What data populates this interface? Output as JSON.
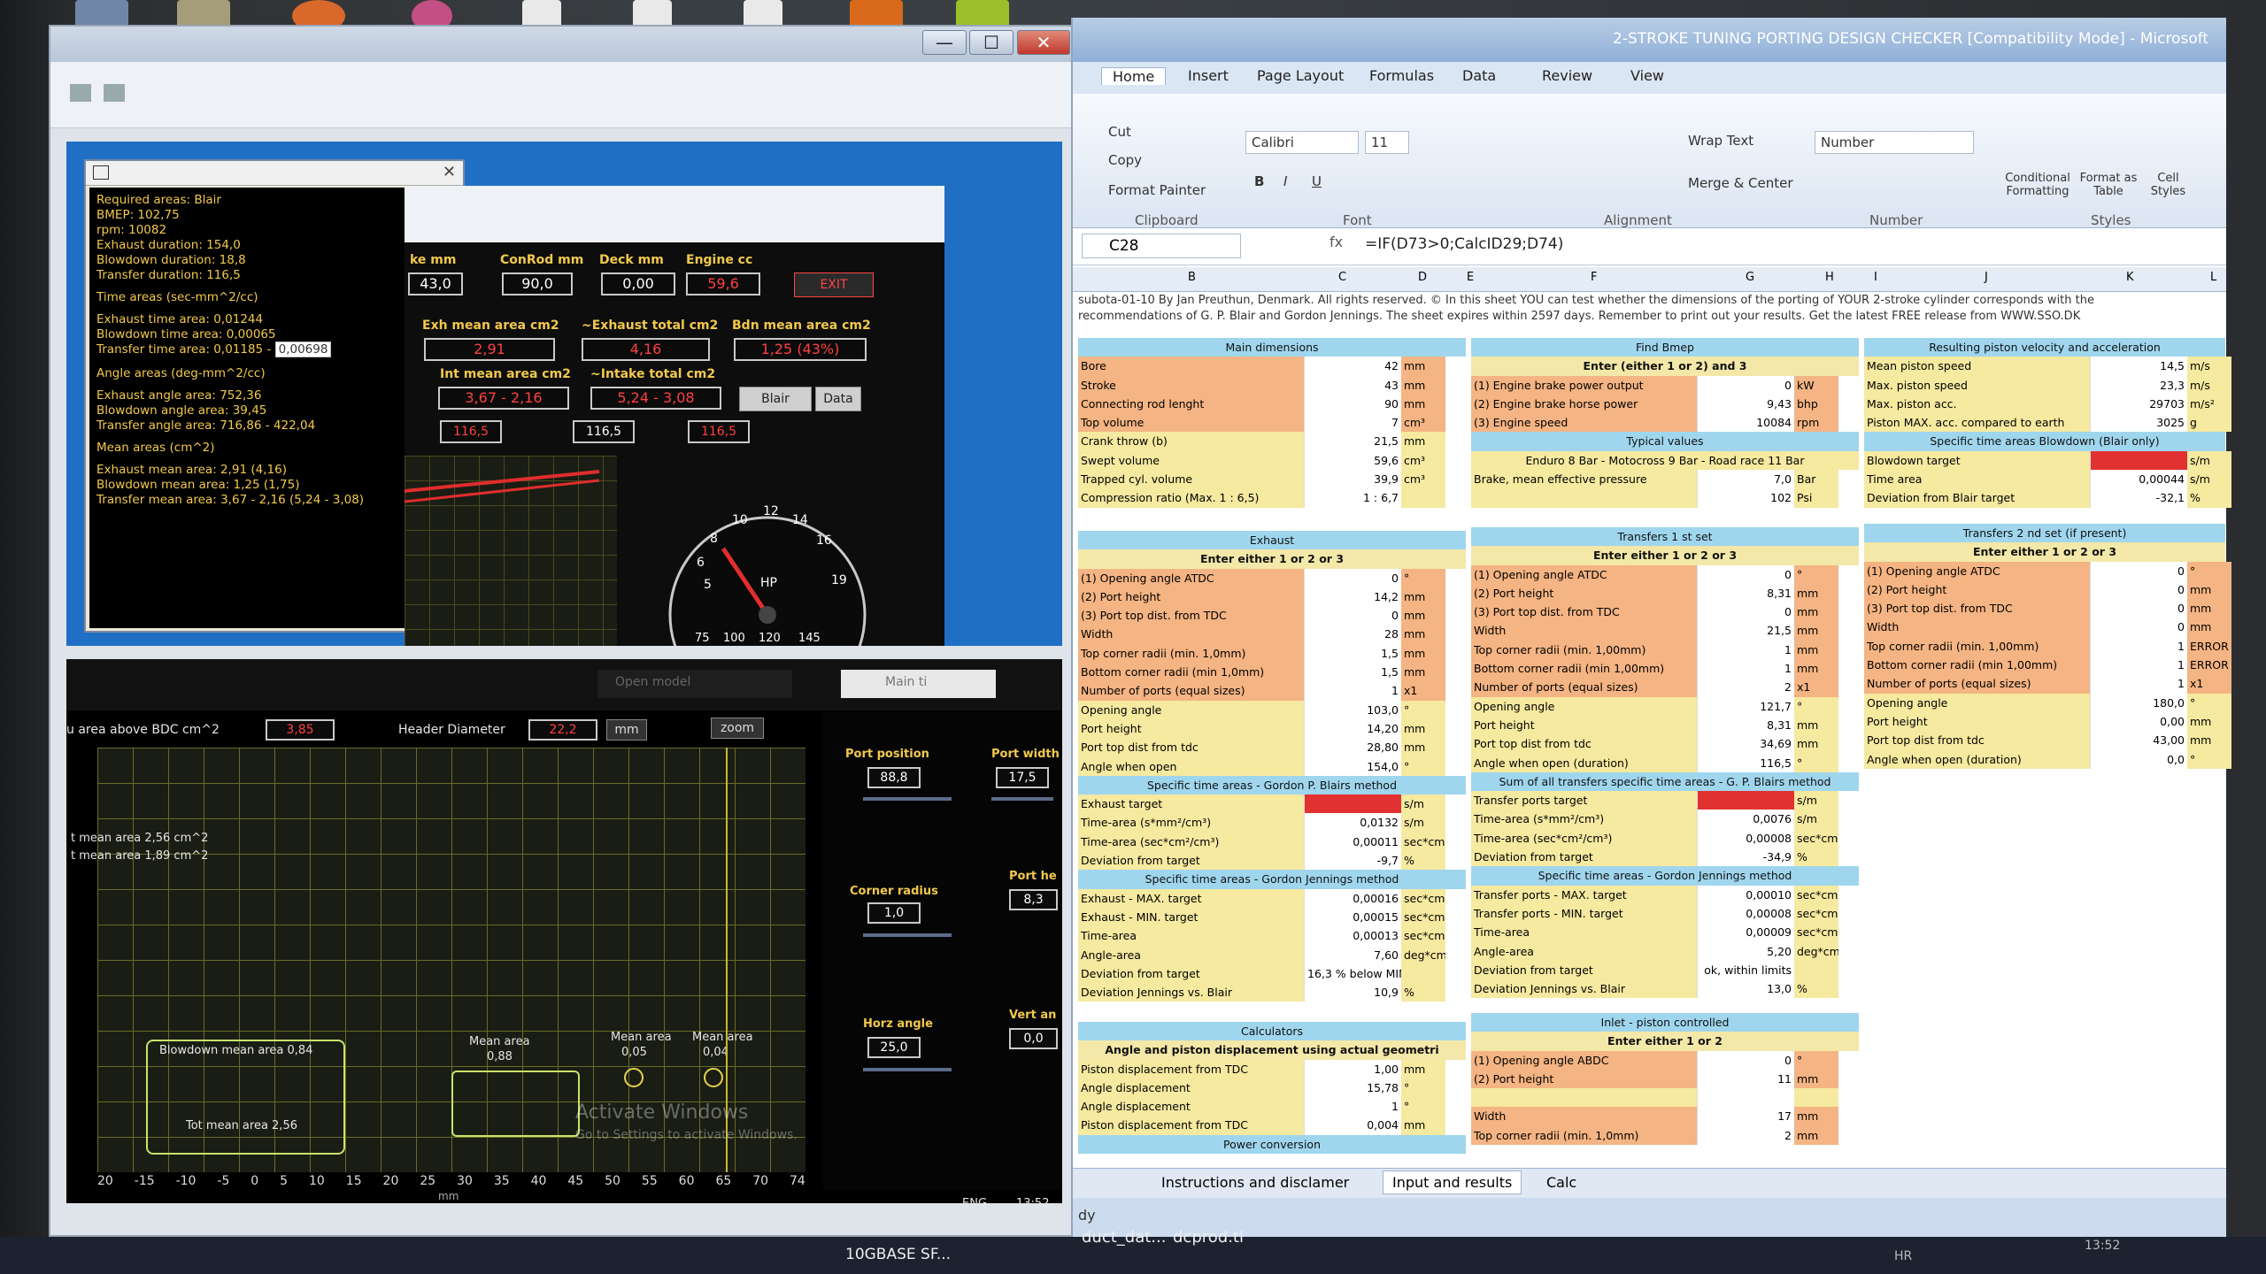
{
  "desktop": {
    "taskbar_items": [
      "10GBASE SF...",
      "duct_dat...",
      "dcprod.tl"
    ],
    "clock": "13:52",
    "lang": "ENG",
    "lang2": "HR"
  },
  "leftwin": {
    "close_label": "✕",
    "min_label": "—",
    "max_label": "☐"
  },
  "info": {
    "lines": [
      "Required areas: Blair",
      "BMEP: 102,75",
      "rpm: 10082",
      "Exhaust duration: 154,0",
      "Blowdown duration: 18,8",
      "Transfer duration: 116,5",
      "",
      "Time areas (sec-mm^2/cc)",
      "",
      "Exhaust time area: 0,01244",
      "Blowdown time area: 0,00065",
      "",
      "",
      "Angle areas (deg-mm^2/cc)",
      "",
      "Exhaust angle area: 752,36",
      "Blowdown angle area: 39,45",
      "Transfer angle area: 716,86 - 422,04",
      "",
      "Mean areas (cm^2)",
      "",
      "Exhaust mean area: 2,91  (4,16)",
      "Blowdown mean area: 1,25  (1,75)",
      "Transfer mean area: 3,67 - 2,16  (5,24 - 3,08)"
    ],
    "transfer_time_label": "Transfer time area: 0,01185 -",
    "transfer_time_sel": "0,00698"
  },
  "tool": {
    "stroke_label": "ke mm",
    "stroke_val": "43,0",
    "conrod_label": "ConRod mm",
    "conrod_val": "90,0",
    "deck_label": "Deck mm",
    "deck_val": "0,00",
    "engine_label": "Engine cc",
    "engine_val": "59,6",
    "exit_label": "EXIT",
    "exh_mean_label": "Exh mean area cm2",
    "exh_mean_val": "2,91",
    "exh_total_label": "~Exhaust total cm2",
    "exh_total_val": "4,16",
    "bdn_mean_label": "Bdn mean area cm2",
    "bdn_mean_val": "1,25  (43%)",
    "int_mean_label": "Int mean area cm2",
    "int_mean_val": "3,67 - 2,16",
    "int_total_label": "~Intake total cm2",
    "int_total_val": "5,24 - 3,08",
    "blair_label": "Blair",
    "data_label": "Data",
    "dur1": "116,5",
    "dur2": "116,5",
    "dur3": "116,5",
    "gauge": {
      "label": "HP",
      "ticks": [
        "5",
        "6",
        "8",
        "10",
        "12",
        "14",
        "16",
        "19"
      ],
      "bottom": [
        "75",
        "100",
        "120",
        "145"
      ]
    }
  },
  "bottom": {
    "area_above_bdc_label": "u area above BDC  cm^2",
    "area_above_bdc_val": "3,85",
    "header_diam_label": "Header Diameter",
    "header_diam_val": "22,2",
    "unit": "mm",
    "zoom": "zoom",
    "mean_area_line1": "t mean area 2,56 cm^2",
    "mean_area_line2": "t mean area 1,89 cm^2",
    "blowdown_mean": "Blowdown mean area 0,84",
    "tot_mean": "Tot mean area 2,56",
    "mean_a1_lbl": "Mean area",
    "mean_a1": "0,88",
    "mean_a2_lbl": "Mean area",
    "mean_a2": "0,05",
    "mean_a3_lbl": "Mean area",
    "mean_a3": "0,04",
    "axis": [
      "20",
      "-15",
      "-10",
      "-5",
      "0",
      "5",
      "10",
      "15",
      "20",
      "25",
      "30",
      "35",
      "40",
      "45",
      "50",
      "55",
      "60",
      "65",
      "70",
      "74"
    ],
    "axis_unit": "mm",
    "open_model": "Open model",
    "main_t": "Main ti",
    "port_pos_label": "Port position",
    "port_pos_val": "88,8",
    "port_width_label": "Port width",
    "port_width_val": "17,5",
    "corner_label": "Corner radius",
    "corner_val": "1,0",
    "port_he_label": "Port he",
    "port_he_val": "8,3",
    "horz_label": "Horz angle",
    "horz_val": "25,0",
    "vert_label": "Vert an",
    "vert_val": "0,0",
    "watermark1": "Activate Windows",
    "watermark2": "Go to Settings to activate Windows."
  },
  "excel": {
    "title": "2-STROKE TUNING PORTING DESIGN CHECKER  [Compatibility Mode] - Microsoft",
    "tabs": [
      "Home",
      "Insert",
      "Page Layout",
      "Formulas",
      "Data",
      "Review",
      "View"
    ],
    "cut": "Cut",
    "copy": "Copy",
    "format_painter": "Format Painter",
    "font": "Calibri",
    "size": "11",
    "wrap": "Wrap Text",
    "merge": "Merge & Center",
    "numfmt": "Number",
    "cond": "Conditional Formatting",
    "fmt_table": "Format as Table",
    "cell_styles": "Cell Styles",
    "groups": [
      "Clipboard",
      "Font",
      "Alignment",
      "Number",
      "Styles"
    ],
    "namebox": "C28",
    "formula": "=IF(D73>0;CalcID29;D74)",
    "cols": [
      "B",
      "C",
      "D",
      "E",
      "F",
      "G",
      "H",
      "I",
      "J",
      "K",
      "L"
    ],
    "note1": "subota-01-10 By Jan Preuthun, Denmark. All rights reserved. © In this sheet YOU can test whether the dimensions of the porting of YOUR 2-stroke cylinder corresponds with the",
    "note2": "recommendations of G. P. Blair and Gordon Jennings. The sheet expires within 2597 days. Remember to print out your results. Get the latest FREE release from WWW.SSO.DK",
    "main_dim": {
      "title": "Main dimensions",
      "rows": [
        [
          "Bore",
          "42",
          "mm"
        ],
        [
          "Stroke",
          "43",
          "mm"
        ],
        [
          "Connecting rod lenght",
          "90",
          "mm"
        ],
        [
          "Top volume",
          "7",
          "cm³"
        ],
        [
          "Crank throw (b)",
          "21,5",
          "mm"
        ],
        [
          "Swept volume",
          "59,6",
          "cm³"
        ],
        [
          "Trapped cyl. volume",
          "39,9",
          "cm³"
        ],
        [
          "Compression ratio (Max. 1 : 6,5)",
          "1 : 6,7",
          ""
        ]
      ]
    },
    "bmep": {
      "title": "Find Bmep",
      "sub": "Enter (either 1 or 2) and 3",
      "rows": [
        [
          "(1) Engine brake power output",
          "0",
          "kW"
        ],
        [
          "(2) Engine brake horse power",
          "9,43",
          "bhp"
        ],
        [
          "(3) Engine speed",
          "10084",
          "rpm"
        ]
      ],
      "typ": "Typical values",
      "typ2": "Enduro 8 Bar - Motocross 9 Bar - Road race 11 Bar",
      "rows2": [
        [
          "Brake, mean effective pressure",
          "7,0",
          "Bar"
        ],
        [
          "",
          "102",
          "Psi"
        ]
      ]
    },
    "piston": {
      "title": "Resulting piston velocity and acceleration",
      "rows": [
        [
          "Mean piston speed",
          "14,5",
          "m/s"
        ],
        [
          "Max. piston speed",
          "23,3",
          "m/s"
        ],
        [
          "Max. piston acc.",
          "29703",
          "m/s²"
        ],
        [
          "Piston MAX. acc. compared to earth",
          "3025",
          "g"
        ]
      ],
      "sub": "Specific time areas Blowdown (Blair only)",
      "rows2": [
        [
          "Blowdown target",
          "",
          "s/m"
        ],
        [
          "Time area",
          "0,00044",
          "s/m"
        ],
        [
          "Deviation from Blair target",
          "-32,1",
          "%"
        ]
      ]
    },
    "exhaust": {
      "title": "Exhaust",
      "sub": "Enter either 1 or 2 or 3",
      "rows": [
        [
          "(1) Opening angle ATDC",
          "0",
          "°"
        ],
        [
          "(2) Port height",
          "14,2",
          "mm"
        ],
        [
          "(3) Port top dist. from TDC",
          "0",
          "mm"
        ],
        [
          "Width",
          "28",
          "mm"
        ],
        [
          "Top corner radii (min. 1,0mm)",
          "1,5",
          "mm"
        ],
        [
          "Bottom corner radii (min 1,0mm)",
          "1,5",
          "mm"
        ],
        [
          "Number of ports (equal sizes)",
          "1",
          "x1"
        ],
        [
          "Opening angle",
          "103,0",
          "°"
        ],
        [
          "Port height",
          "14,20",
          "mm"
        ],
        [
          "Port top dist from tdc",
          "28,80",
          "mm"
        ],
        [
          "Angle when open",
          "154,0",
          "°"
        ]
      ],
      "blair": "Specific time areas - Gordon P. Blairs method",
      "brows": [
        [
          "Exhaust target",
          "",
          "s/m"
        ],
        [
          "Time-area (s*mm²/cm³)",
          "0,0132",
          "s/m"
        ],
        [
          "Time-area (sec*cm²/cm³)",
          "0,00011",
          "sec*cm²/cm³"
        ],
        [
          "Deviation from target",
          "-9,7",
          "%"
        ]
      ],
      "jen": "Specific time areas - Gordon Jennings method",
      "jrows": [
        [
          "Exhaust - MAX. target",
          "0,00016",
          "sec*cm²/cm³"
        ],
        [
          "Exhaust - MIN. target",
          "0,00015",
          "sec*cm²/cm³"
        ],
        [
          "Time-area",
          "0,00013",
          "sec*cm²/cm³"
        ],
        [
          "Angle-area",
          "7,60",
          "deg*cm²/cm³"
        ],
        [
          "Deviation from target",
          "16,3 % below MIN limit",
          ""
        ],
        [
          "Deviation Jennings vs. Blair",
          "10,9",
          "%"
        ]
      ]
    },
    "transfers": {
      "title": "Transfers 1 st set",
      "sub": "Enter either 1 or 2 or 3",
      "rows": [
        [
          "(1) Opening angle ATDC",
          "0",
          "°"
        ],
        [
          "(2) Port height",
          "8,31",
          "mm"
        ],
        [
          "(3) Port top dist. from TDC",
          "0",
          "mm"
        ],
        [
          "Width",
          "21,5",
          "mm"
        ],
        [
          "Top corner radii (min. 1,00mm)",
          "1",
          "mm"
        ],
        [
          "Bottom corner radii (min 1,00mm)",
          "1",
          "mm"
        ],
        [
          "Number of ports (equal sizes)",
          "2",
          "x1"
        ],
        [
          "Opening angle",
          "121,7",
          "°"
        ],
        [
          "Port height",
          "8,31",
          "mm"
        ],
        [
          "Port top dist from tdc",
          "34,69",
          "mm"
        ],
        [
          "Angle when open (duration)",
          "116,5",
          "°"
        ]
      ],
      "blair": "Sum of all transfers specific time areas - G. P. Blairs method",
      "brows": [
        [
          "Transfer ports target",
          "",
          "s/m"
        ],
        [
          "Time-area (s*mm²/cm³)",
          "0,0076",
          "s/m"
        ],
        [
          "Time-area (sec*cm²/cm³)",
          "0,00008",
          "sec*cm²/cm³"
        ],
        [
          "Deviation from target",
          "-34,9",
          "%"
        ]
      ],
      "jen": "Specific time areas - Gordon Jennings method",
      "jrows": [
        [
          "Transfer ports - MAX. target",
          "0,00010",
          "sec*cm²/cm³"
        ],
        [
          "Transfer ports - MIN. target",
          "0,00008",
          "sec*cm²/cm³"
        ],
        [
          "Time-area",
          "0,00009",
          "sec*cm²/cm³"
        ],
        [
          "Angle-area",
          "5,20",
          "deg*cm²/cm³"
        ],
        [
          "Deviation from target",
          "ok, within limits",
          ""
        ],
        [
          "Deviation Jennings vs. Blair",
          "13,0",
          "%"
        ]
      ]
    },
    "transfers2": {
      "title": "Transfers 2 nd set (if present)",
      "sub": "Enter either 1 or 2 or 3",
      "rows": [
        [
          "(1) Opening angle ATDC",
          "0",
          "°"
        ],
        [
          "(2) Port height",
          "0",
          "mm"
        ],
        [
          "(3) Port top dist. from TDC",
          "0",
          "mm"
        ],
        [
          "Width",
          "0",
          "mm"
        ],
        [
          "Top corner radii (min. 1,00mm)",
          "1",
          "ERROR"
        ],
        [
          "Bottom corner radii (min 1,00mm)",
          "1",
          "ERROR"
        ],
        [
          "Number of ports (equal sizes)",
          "1",
          "x1"
        ],
        [
          "Opening angle",
          "180,0",
          "°"
        ],
        [
          "Port height",
          "0,00",
          "mm"
        ],
        [
          "Port top dist from tdc",
          "43,00",
          "mm"
        ],
        [
          "Angle when open (duration)",
          "0,0",
          "°"
        ]
      ]
    },
    "calc": {
      "title": "Calculators",
      "sub": "Angle and piston displacement using actual geometri",
      "rows": [
        [
          "Piston displacement from TDC",
          "1,00",
          "mm"
        ],
        [
          "Angle displacement",
          "15,78",
          "°"
        ],
        [
          "Angle displacement",
          "1",
          "°"
        ],
        [
          "Piston displacement from TDC",
          "0,004",
          "mm"
        ]
      ],
      "power": "Power conversion"
    },
    "inlet": {
      "title": "Inlet - piston controlled",
      "sub": "Enter either 1 or 2",
      "rows": [
        [
          "(1) Opening angle ABDC",
          "0",
          "°"
        ],
        [
          "(2) Port height",
          "11",
          "mm"
        ],
        [
          "",
          "",
          " "
        ],
        [
          "Width",
          "17",
          "mm"
        ],
        [
          "Top corner radii (min. 1,0mm)",
          "2",
          "mm"
        ]
      ]
    },
    "sheettabs": [
      "Instructions and disclamer",
      "Input and results",
      "Calc"
    ],
    "status": "dy"
  }
}
